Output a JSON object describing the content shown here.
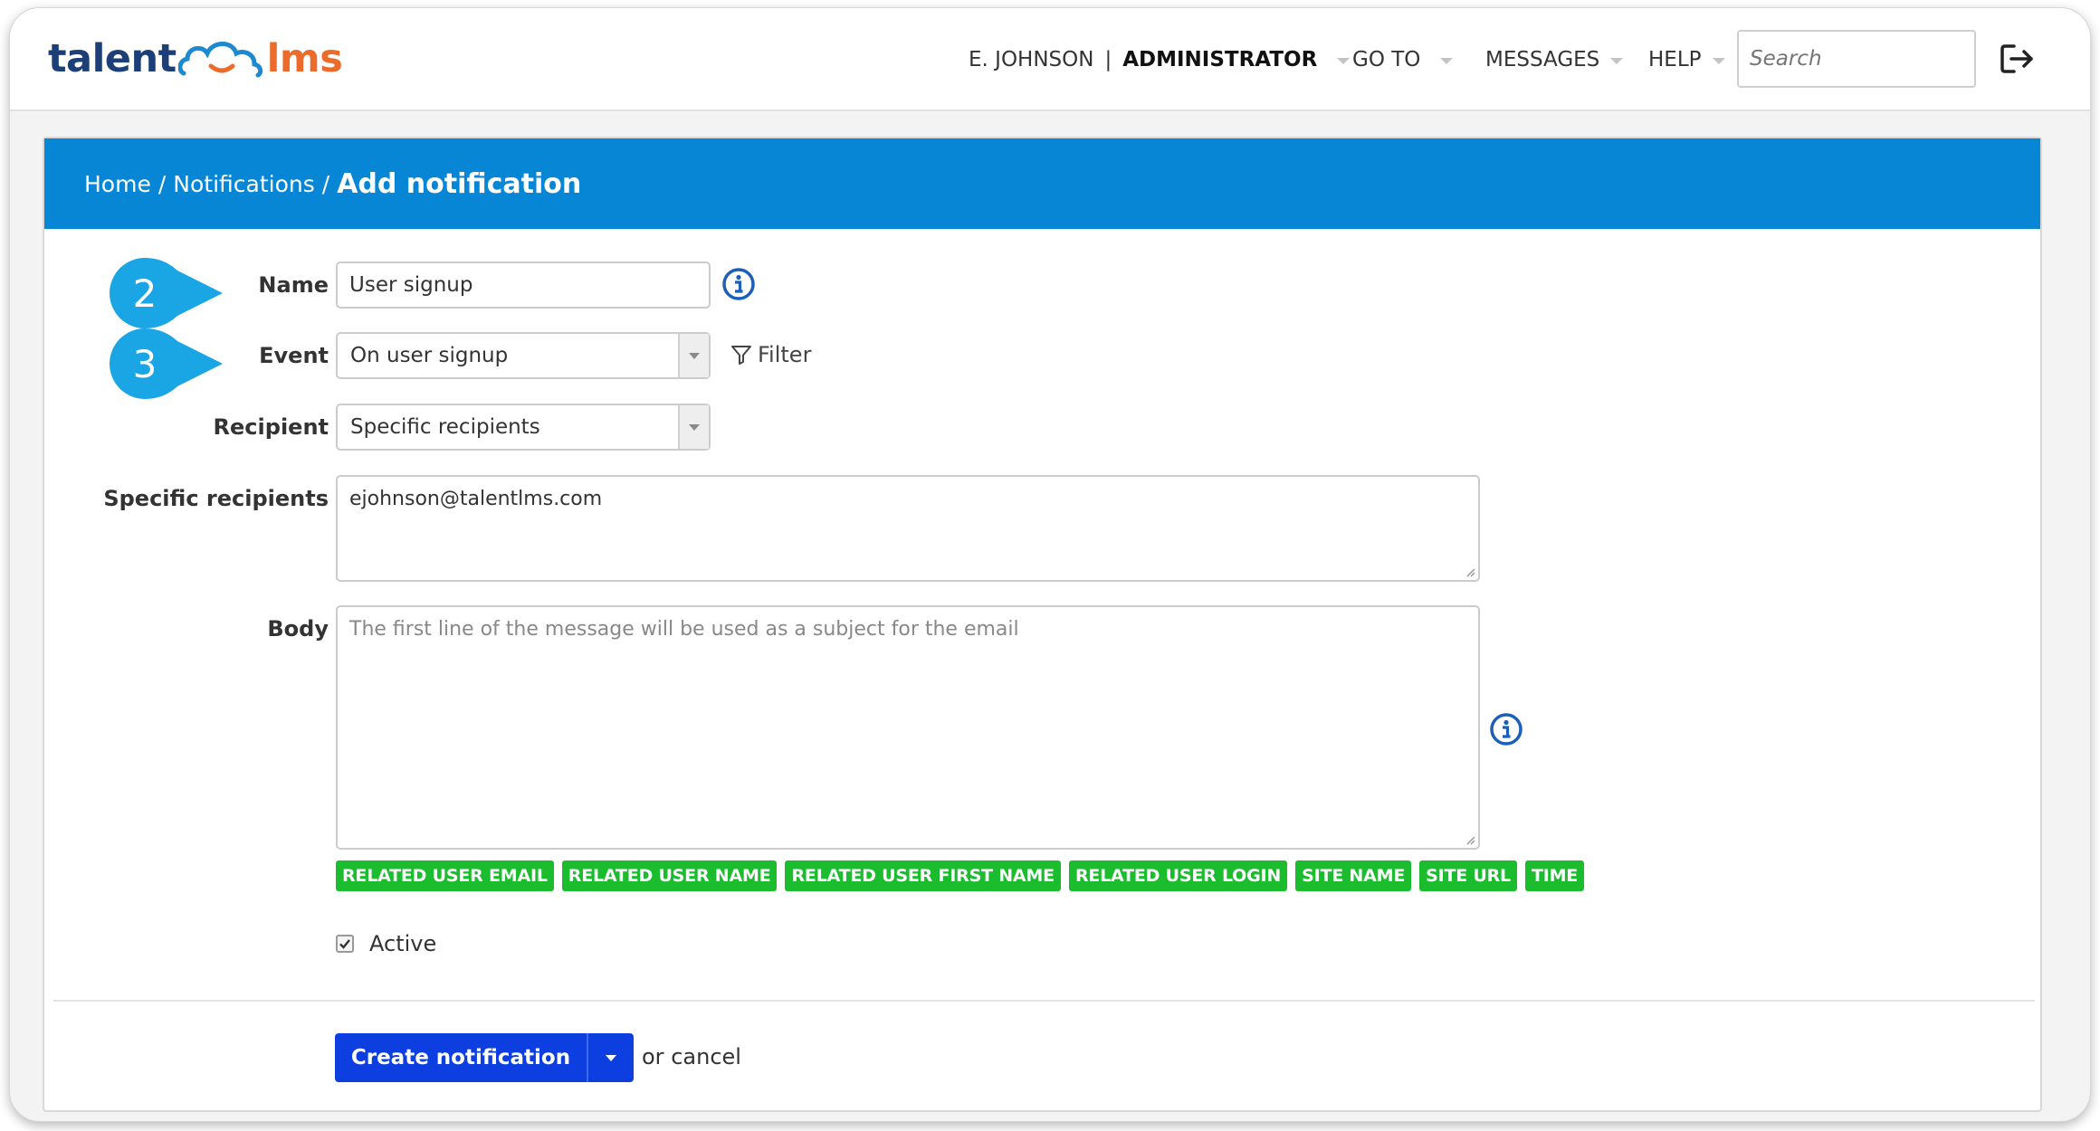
{
  "header": {
    "logo": {
      "part1": "talent",
      "part2": "lms"
    },
    "user": {
      "name": "E. JOHNSON",
      "separator": "|",
      "role": "ADMINISTRATOR"
    },
    "nav": {
      "goto": "GO TO",
      "messages": "MESSAGES",
      "help": "HELP"
    },
    "search": {
      "placeholder": "Search"
    }
  },
  "breadcrumb": {
    "home": "Home",
    "sep1": "/",
    "notifications": "Notifications",
    "sep2": "/",
    "current": "Add notification"
  },
  "form": {
    "name": {
      "label": "Name",
      "value": "User signup"
    },
    "event": {
      "label": "Event",
      "value": "On user signup"
    },
    "filter": {
      "label": "Filter"
    },
    "recipient": {
      "label": "Recipient",
      "value": "Specific recipients"
    },
    "specific_recipients": {
      "label": "Specific recipients",
      "value": "ejohnson@talentlms.com"
    },
    "body": {
      "label": "Body",
      "placeholder": "The first line of the message will be used as a subject for the email"
    },
    "tags": [
      "RELATED USER EMAIL",
      "RELATED USER NAME",
      "RELATED USER FIRST NAME",
      "RELATED USER LOGIN",
      "SITE NAME",
      "SITE URL",
      "TIME"
    ],
    "active": {
      "label": "Active",
      "checked": true
    }
  },
  "actions": {
    "create": "Create notification",
    "or": "or",
    "cancel": "cancel"
  },
  "callouts": {
    "step_name": "2",
    "step_event": "3"
  },
  "colors": {
    "header_blue": "#0786d6",
    "button_blue": "#0d3fe0",
    "tag_green": "#1bbd2f",
    "callout_blue": "#1aa6e4",
    "logo_navy": "#1d3f77",
    "logo_orange": "#ec6b2a"
  }
}
